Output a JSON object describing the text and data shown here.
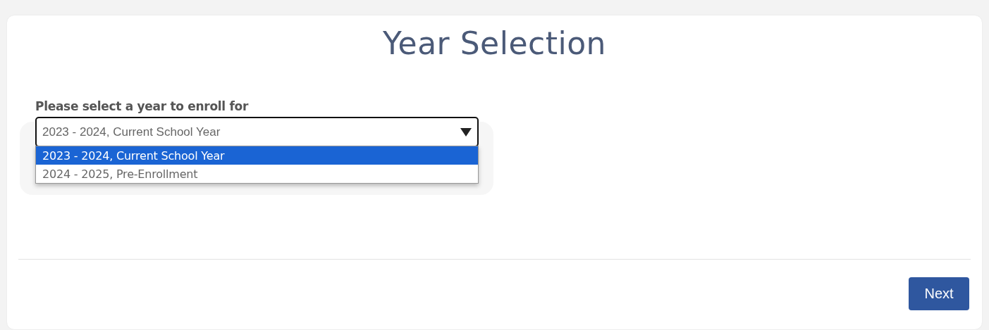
{
  "title": "Year Selection",
  "year_select": {
    "label": "Please select a year to enroll for",
    "value": "2023 - 2024, Current School Year",
    "expanded": true,
    "options": [
      {
        "label": "2023 - 2024, Current School Year",
        "selected": true
      },
      {
        "label": "2024 - 2025, Pre-Enrollment",
        "selected": false
      }
    ]
  },
  "buttons": [
    {
      "label": "Next"
    }
  ]
}
